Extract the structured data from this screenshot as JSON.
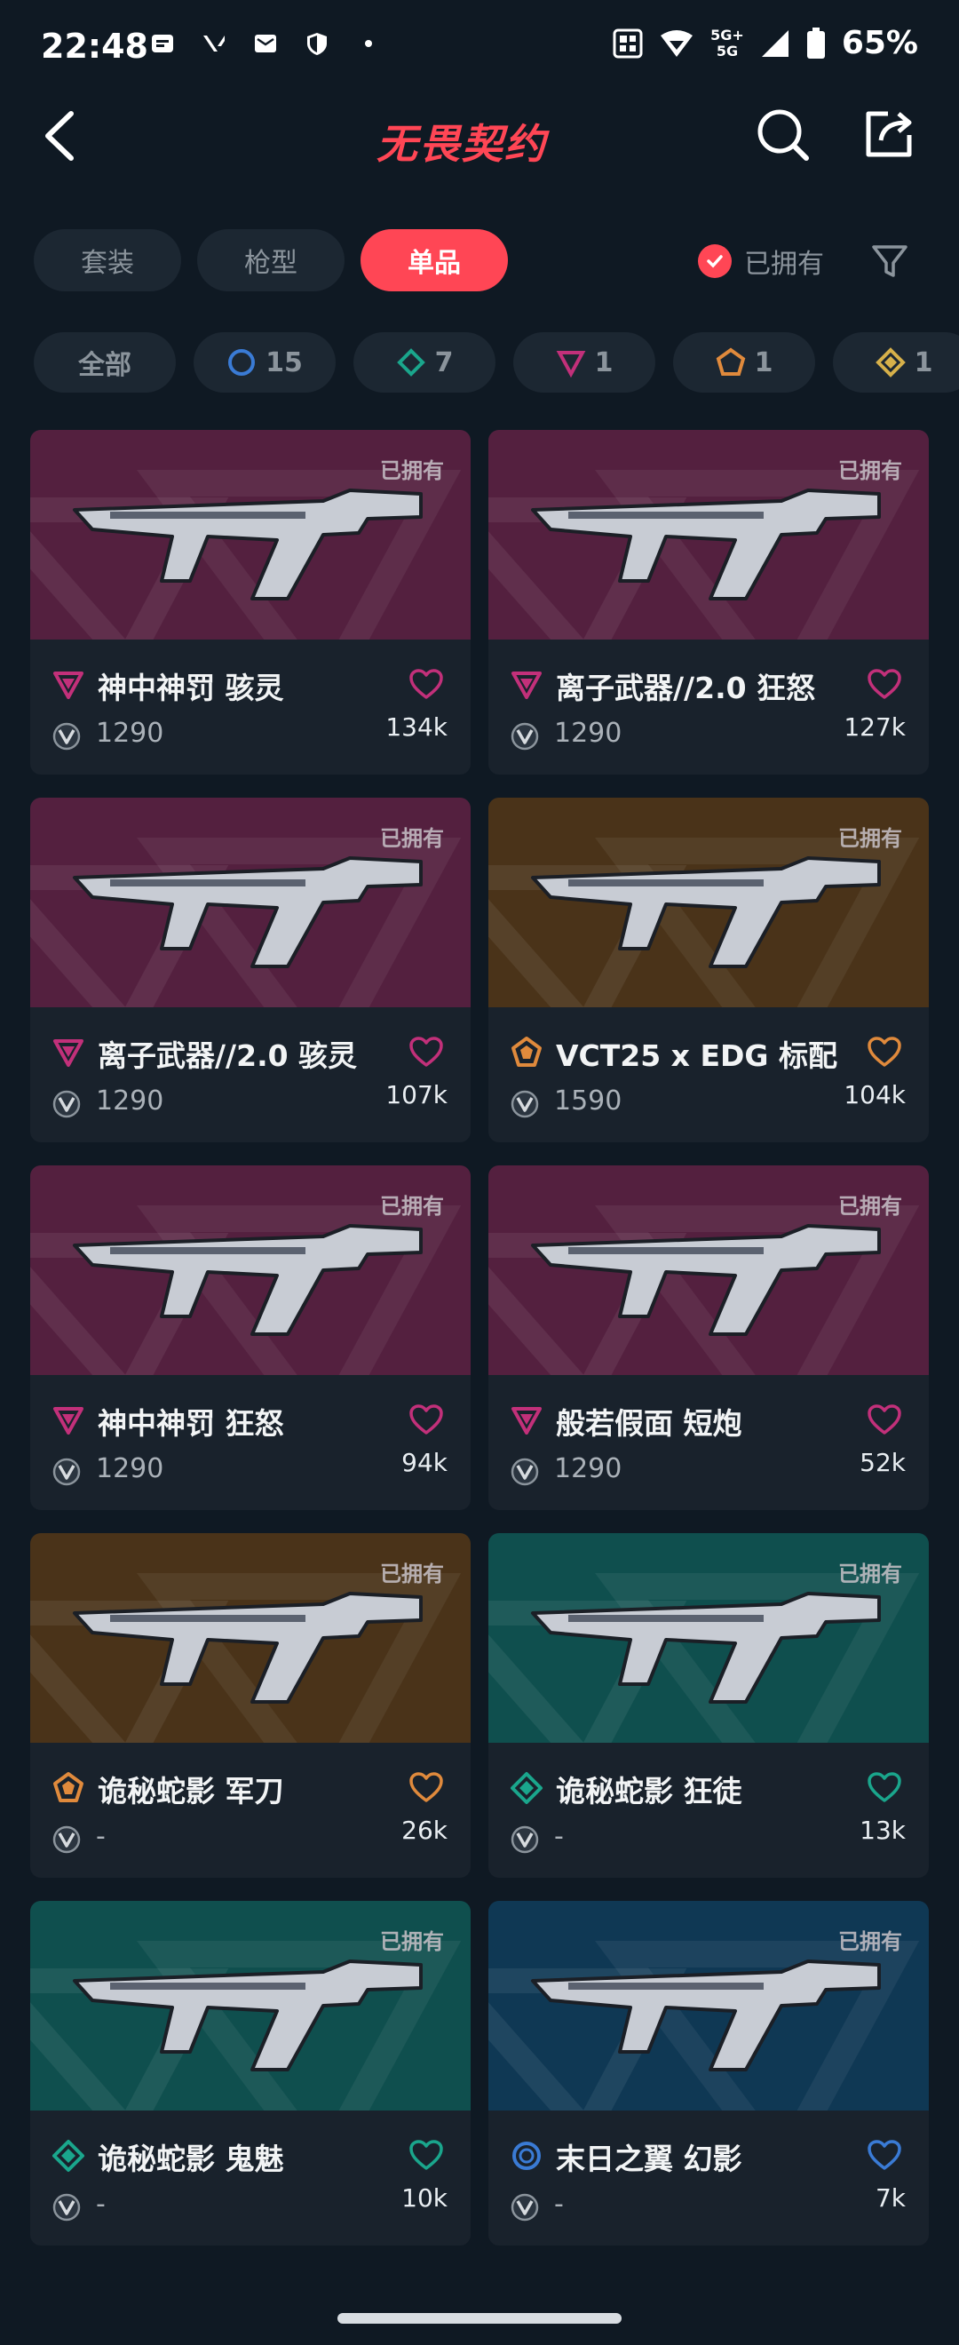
{
  "status_bar": {
    "time": "22:48",
    "battery": "65%",
    "net_line1": "5G+",
    "net_line2": "5G"
  },
  "header": {
    "title": "无畏契约"
  },
  "tabs": [
    {
      "label": "套装",
      "active": false
    },
    {
      "label": "枪型",
      "active": false
    },
    {
      "label": "单品",
      "active": true
    }
  ],
  "owned_filter": {
    "label": "已拥有",
    "checked": true
  },
  "rarity_chips": [
    {
      "label": "全部",
      "icon": "none"
    },
    {
      "label": "15",
      "icon": "select-tier-icon",
      "color": "#3a7bd5"
    },
    {
      "label": "7",
      "icon": "deluxe-tier-icon",
      "color": "#1aa68c"
    },
    {
      "label": "1",
      "icon": "premium-tier-icon",
      "color": "#c2307a"
    },
    {
      "label": "1",
      "icon": "exclusive-tier-icon",
      "color": "#e08a3c"
    },
    {
      "label": "1",
      "icon": "ultra-tier-icon",
      "color": "#d6b04a"
    }
  ],
  "owned_badge_text": "已拥有",
  "skins": [
    {
      "name": "神中神罚 骇灵",
      "price": "1290",
      "likes": "134k",
      "rarity": "premium",
      "bg": "purple"
    },
    {
      "name": "离子武器//2.0 狂怒",
      "price": "1290",
      "likes": "127k",
      "rarity": "premium",
      "bg": "purple"
    },
    {
      "name": "离子武器//2.0 骇灵",
      "price": "1290",
      "likes": "107k",
      "rarity": "premium",
      "bg": "purple"
    },
    {
      "name": "VCT25 x EDG 标配",
      "price": "1590",
      "likes": "104k",
      "rarity": "exclusive",
      "bg": "orange"
    },
    {
      "name": "神中神罚 狂怒",
      "price": "1290",
      "likes": "94k",
      "rarity": "premium",
      "bg": "purple"
    },
    {
      "name": "般若假面 短炮",
      "price": "1290",
      "likes": "52k",
      "rarity": "premium",
      "bg": "purple"
    },
    {
      "name": "诡秘蛇影 军刀",
      "price": "-",
      "likes": "26k",
      "rarity": "exclusive",
      "bg": "orange"
    },
    {
      "name": "诡秘蛇影 狂徒",
      "price": "-",
      "likes": "13k",
      "rarity": "deluxe",
      "bg": "teal"
    },
    {
      "name": "诡秘蛇影 鬼魅",
      "price": "-",
      "likes": "10k",
      "rarity": "deluxe",
      "bg": "teal"
    },
    {
      "name": "末日之翼 幻影",
      "price": "-",
      "likes": "7k",
      "rarity": "select",
      "bg": "blue"
    }
  ],
  "colors": {
    "accent": "#ff4655",
    "premium": "#c2307a",
    "exclusive": "#e08a3c",
    "deluxe": "#1aa68c",
    "select": "#3a7bd5"
  }
}
